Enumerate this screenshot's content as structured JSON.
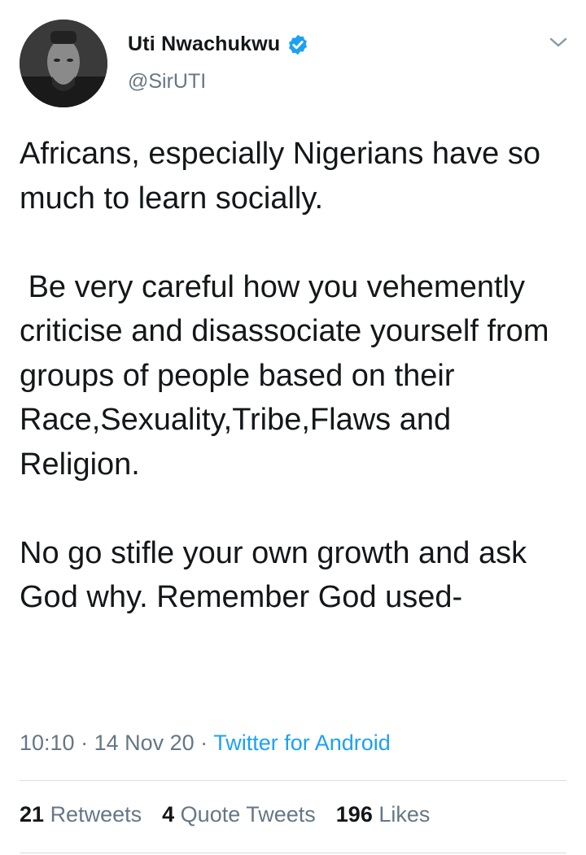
{
  "author": {
    "name": "Uti Nwachukwu",
    "handle": "@SirUTI",
    "verified": true
  },
  "tweet": {
    "paragraphs": [
      "Africans, especially Nigerians have so much to learn socially.",
      " Be very careful how you vehemently criticise and disassociate yourself from groups of people based on their Race,Sexuality,Tribe,Flaws and Religion.",
      "No go stifle your own growth and ask God why. Remember God used-"
    ]
  },
  "meta": {
    "time": "10:10",
    "sep1": " · ",
    "date": "14 Nov 20",
    "sep2": " · ",
    "source": "Twitter for Android"
  },
  "stats": {
    "retweets_count": "21",
    "retweets_label": "Retweets",
    "quotes_count": "4",
    "quotes_label": "Quote Tweets",
    "likes_count": "196",
    "likes_label": "Likes"
  },
  "icons": {
    "verified": "verified-badge-icon",
    "caret": "chevron-down-icon"
  },
  "colors": {
    "text": "#14171a",
    "secondary": "#657786",
    "accent": "#1da1f2",
    "divider": "#d5dde3"
  }
}
